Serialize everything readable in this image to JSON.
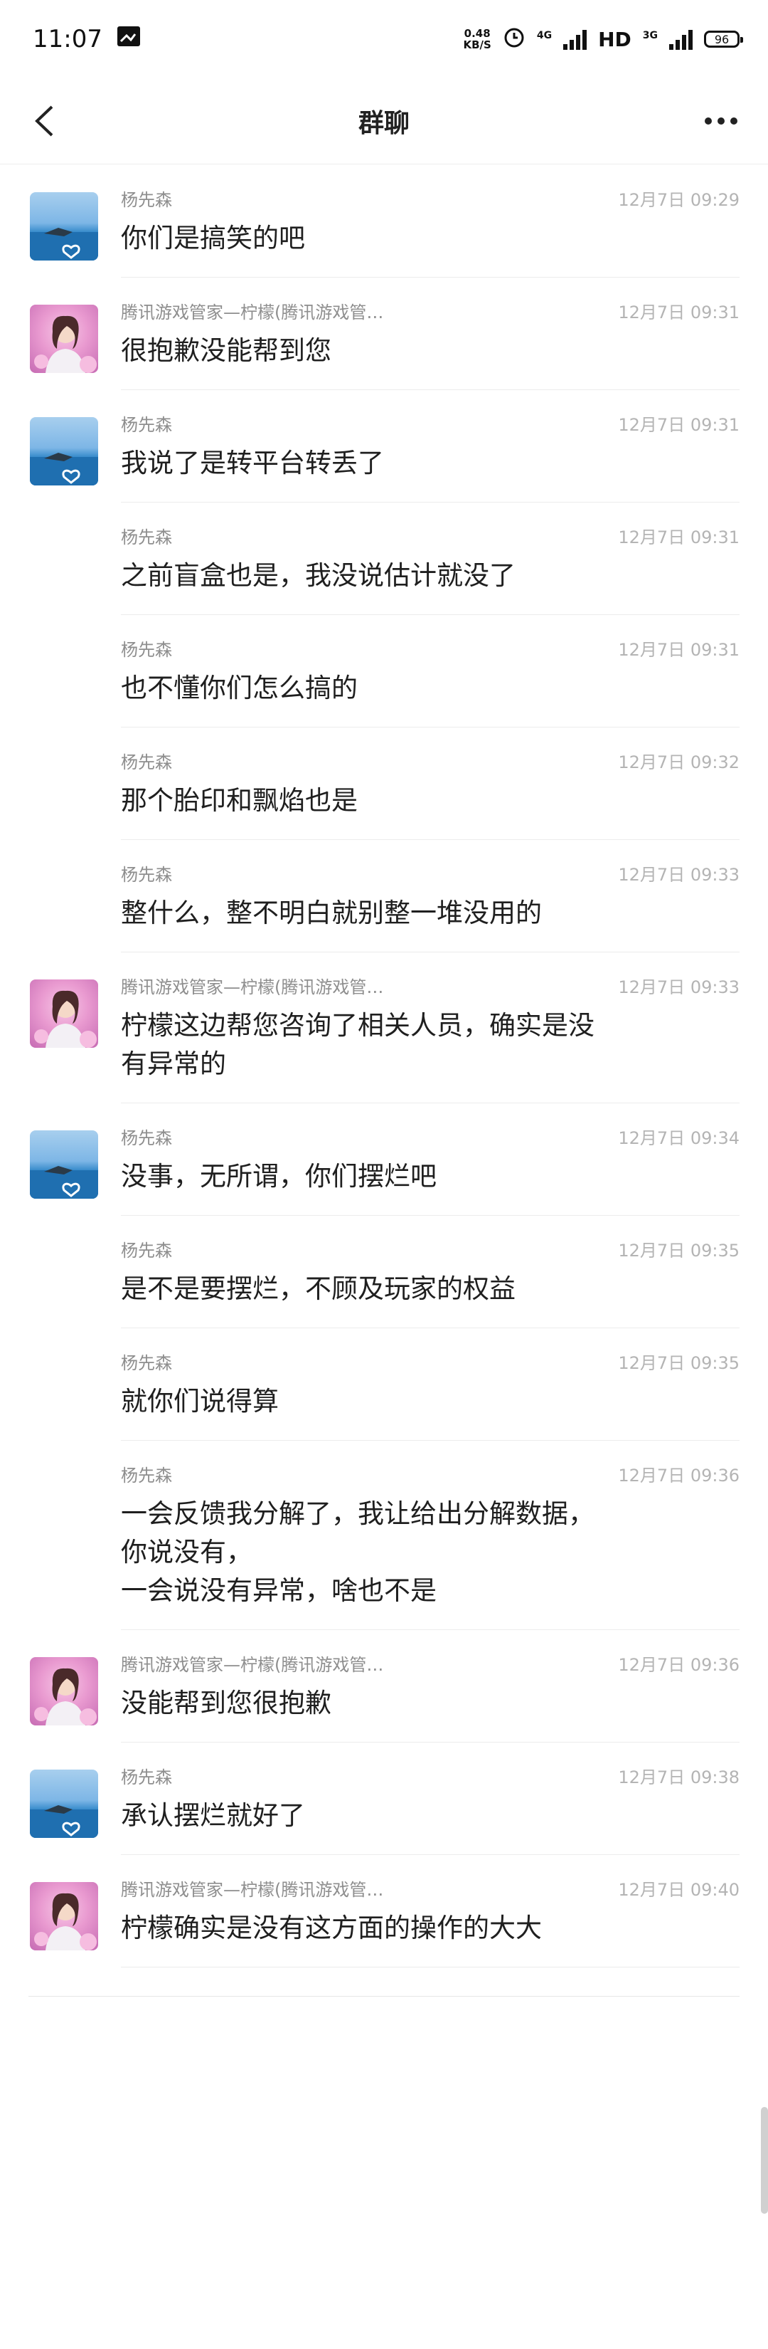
{
  "status_bar": {
    "time": "11:07",
    "net_speed": "0.48",
    "net_unit": "KB/S",
    "net_type_1": "4G",
    "hd": "HD",
    "net_type_2": "3G",
    "battery": "96"
  },
  "header": {
    "title": "群聊"
  },
  "messages": [
    {
      "sender": "杨先森",
      "time": "12月7日  09:29",
      "text": "你们是搞笑的吧",
      "avatar": "sea"
    },
    {
      "sender": "腾讯游戏管家—柠檬(腾讯游戏管…",
      "time": "12月7日  09:31",
      "text": "很抱歉没能帮到您",
      "avatar": "girl"
    },
    {
      "sender": "杨先森",
      "time": "12月7日  09:31",
      "text": "我说了是转平台转丢了",
      "avatar": "sea"
    },
    {
      "sender": "杨先森",
      "time": "12月7日  09:31",
      "text": "之前盲盒也是，我没说估计就没了",
      "avatar": ""
    },
    {
      "sender": "杨先森",
      "time": "12月7日  09:31",
      "text": "也不懂你们怎么搞的",
      "avatar": ""
    },
    {
      "sender": "杨先森",
      "time": "12月7日  09:32",
      "text": "那个胎印和飘焰也是",
      "avatar": ""
    },
    {
      "sender": "杨先森",
      "time": "12月7日  09:33",
      "text": "整什么，整不明白就别整一堆没用的",
      "avatar": ""
    },
    {
      "sender": "腾讯游戏管家—柠檬(腾讯游戏管…",
      "time": "12月7日  09:33",
      "text": "柠檬这边帮您咨询了相关人员，确实是没\n有异常的",
      "avatar": "girl"
    },
    {
      "sender": "杨先森",
      "time": "12月7日  09:34",
      "text": "没事，无所谓，你们摆烂吧",
      "avatar": "sea"
    },
    {
      "sender": "杨先森",
      "time": "12月7日  09:35",
      "text": "是不是要摆烂，不顾及玩家的权益",
      "avatar": ""
    },
    {
      "sender": "杨先森",
      "time": "12月7日  09:35",
      "text": "就你们说得算",
      "avatar": ""
    },
    {
      "sender": "杨先森",
      "time": "12月7日  09:36",
      "text": "一会反馈我分解了，我让给出分解数据，\n你说没有，\n一会说没有异常，啥也不是",
      "avatar": ""
    },
    {
      "sender": "腾讯游戏管家—柠檬(腾讯游戏管…",
      "time": "12月7日  09:36",
      "text": "没能帮到您很抱歉",
      "avatar": "girl"
    },
    {
      "sender": "杨先森",
      "time": "12月7日  09:38",
      "text": "承认摆烂就好了",
      "avatar": "sea"
    },
    {
      "sender": "腾讯游戏管家—柠檬(腾讯游戏管…",
      "time": "12月7日  09:40",
      "text": "柠檬确实是没有这方面的操作的大大",
      "avatar": "girl"
    }
  ]
}
